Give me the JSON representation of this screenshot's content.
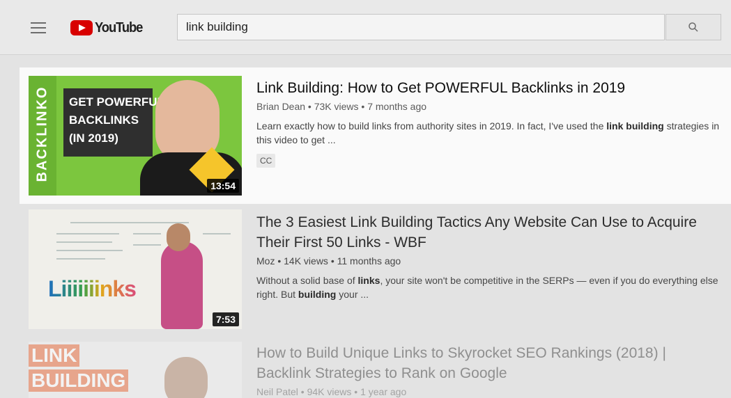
{
  "header": {
    "logo_text": "YouTube",
    "search_value": "link building"
  },
  "results": [
    {
      "title": "Link Building: How to Get POWERFUL Backlinks in 2019",
      "meta": "Brian Dean • 73K views • 7 months ago",
      "desc_1": "Learn exactly how to build links from authority sites in 2019. In fact, I've used the ",
      "desc_bold_1": "link building",
      "desc_2": " strategies in this video to get ...",
      "badge": "CC",
      "duration": "13:54",
      "thumb_side_text": "BACKLINKO",
      "thumb_line_1": "GET POWERFUL",
      "thumb_line_2": "BACKLINKS",
      "thumb_line_3": "(IN 2019)"
    },
    {
      "title": "The 3 Easiest Link Building Tactics Any Website Can Use to Acquire Their First 50 Links - WBF",
      "meta": "Moz • 14K views • 11 months ago",
      "desc_1": "Without a solid base of ",
      "desc_bold_1": "links",
      "desc_2": ", your site won't be competitive in the SERPs — even if you do everything else right. But ",
      "desc_bold_2": "building",
      "desc_3": " your ...",
      "duration": "7:53",
      "thumb_word": "Liiiiiiinks"
    },
    {
      "title": "How to Build Unique Links to Skyrocket SEO Rankings (2018) | Backlink Strategies to Rank on Google",
      "meta": "Neil Patel • 94K views • 1 year ago",
      "thumb_tag_1": "LINK",
      "thumb_tag_2": "BUILDING"
    }
  ]
}
